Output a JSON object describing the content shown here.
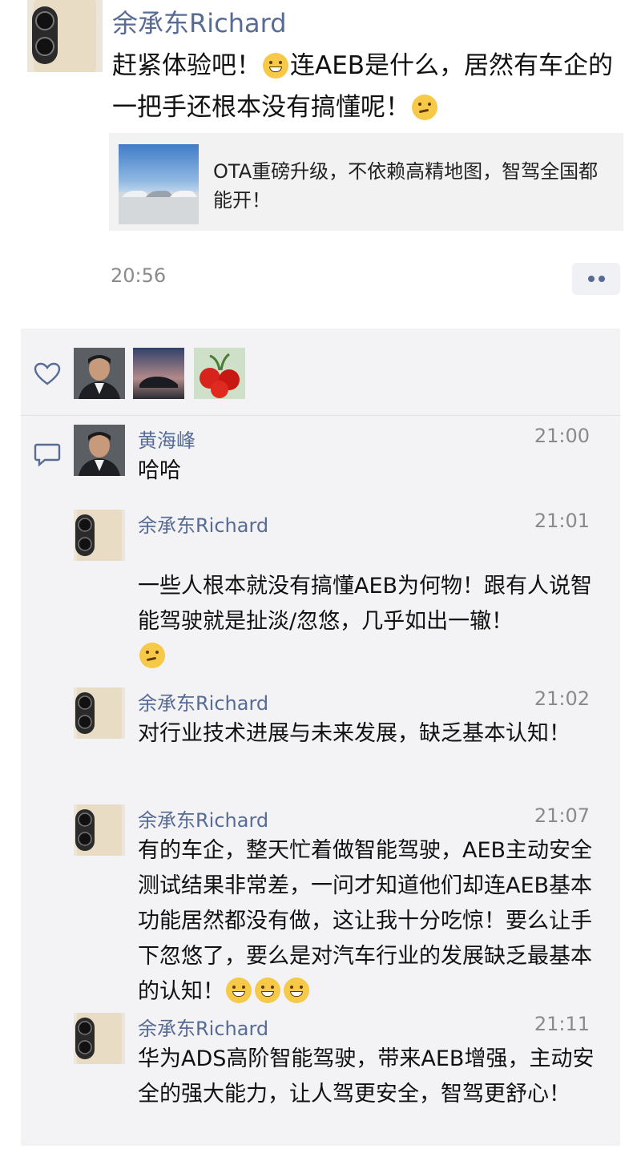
{
  "post": {
    "author": "余承东Richard",
    "text_part1": "赶紧体验吧！",
    "text_part2": "连AEB是什么，居然有车企的一把手还根本没有搞懂呢！",
    "emoji_1": "grinning-emoji",
    "emoji_2": "thinking-emoji",
    "link_card": {
      "title": "OTA重磅升级，不依赖高精地图，智驾全国都能开！"
    },
    "time": "20:56"
  },
  "likes": {
    "icon": "heart-icon",
    "users": [
      "portrait-avatar",
      "car-avatar",
      "cherry-avatar"
    ]
  },
  "comments": [
    {
      "name": "黄海峰",
      "time": "21:00",
      "text": "哈哈",
      "avatar": "portrait-avatar"
    },
    {
      "name": "余承东Richard",
      "time": "21:01",
      "text": "一些人根本就没有搞懂AEB为何物！跟有人说智能驾驶就是扯淡/忽悠，几乎如出一辙！",
      "avatar": "phone-avatar",
      "emoji": "thinking-emoji"
    },
    {
      "name": "余承东Richard",
      "time": "21:02",
      "text": "对行业技术进展与未来发展，缺乏基本认知！",
      "avatar": "phone-avatar"
    },
    {
      "name": "余承东Richard",
      "time": "21:07",
      "text": "有的车企，整天忙着做智能驾驶，AEB主动安全测试结果非常差，一问才知道他们却连AEB基本功能居然都没有做，这让我十分吃惊！要么让手下忽悠了，要么是对汽车行业的发展缺乏最基本的认知！",
      "avatar": "phone-avatar",
      "emoji": "grinning-emoji x3"
    },
    {
      "name": "余承东Richard",
      "time": "21:11",
      "text": "华为ADS高阶智能驾驶，带来AEB增强，主动安全的强大能力，让人驾更安全，智驾更舒心！",
      "avatar": "phone-avatar"
    }
  ],
  "colors": {
    "name_link": "#576b95",
    "comment_bg": "#f3f3f5",
    "time_gray": "#8a8a8a"
  }
}
